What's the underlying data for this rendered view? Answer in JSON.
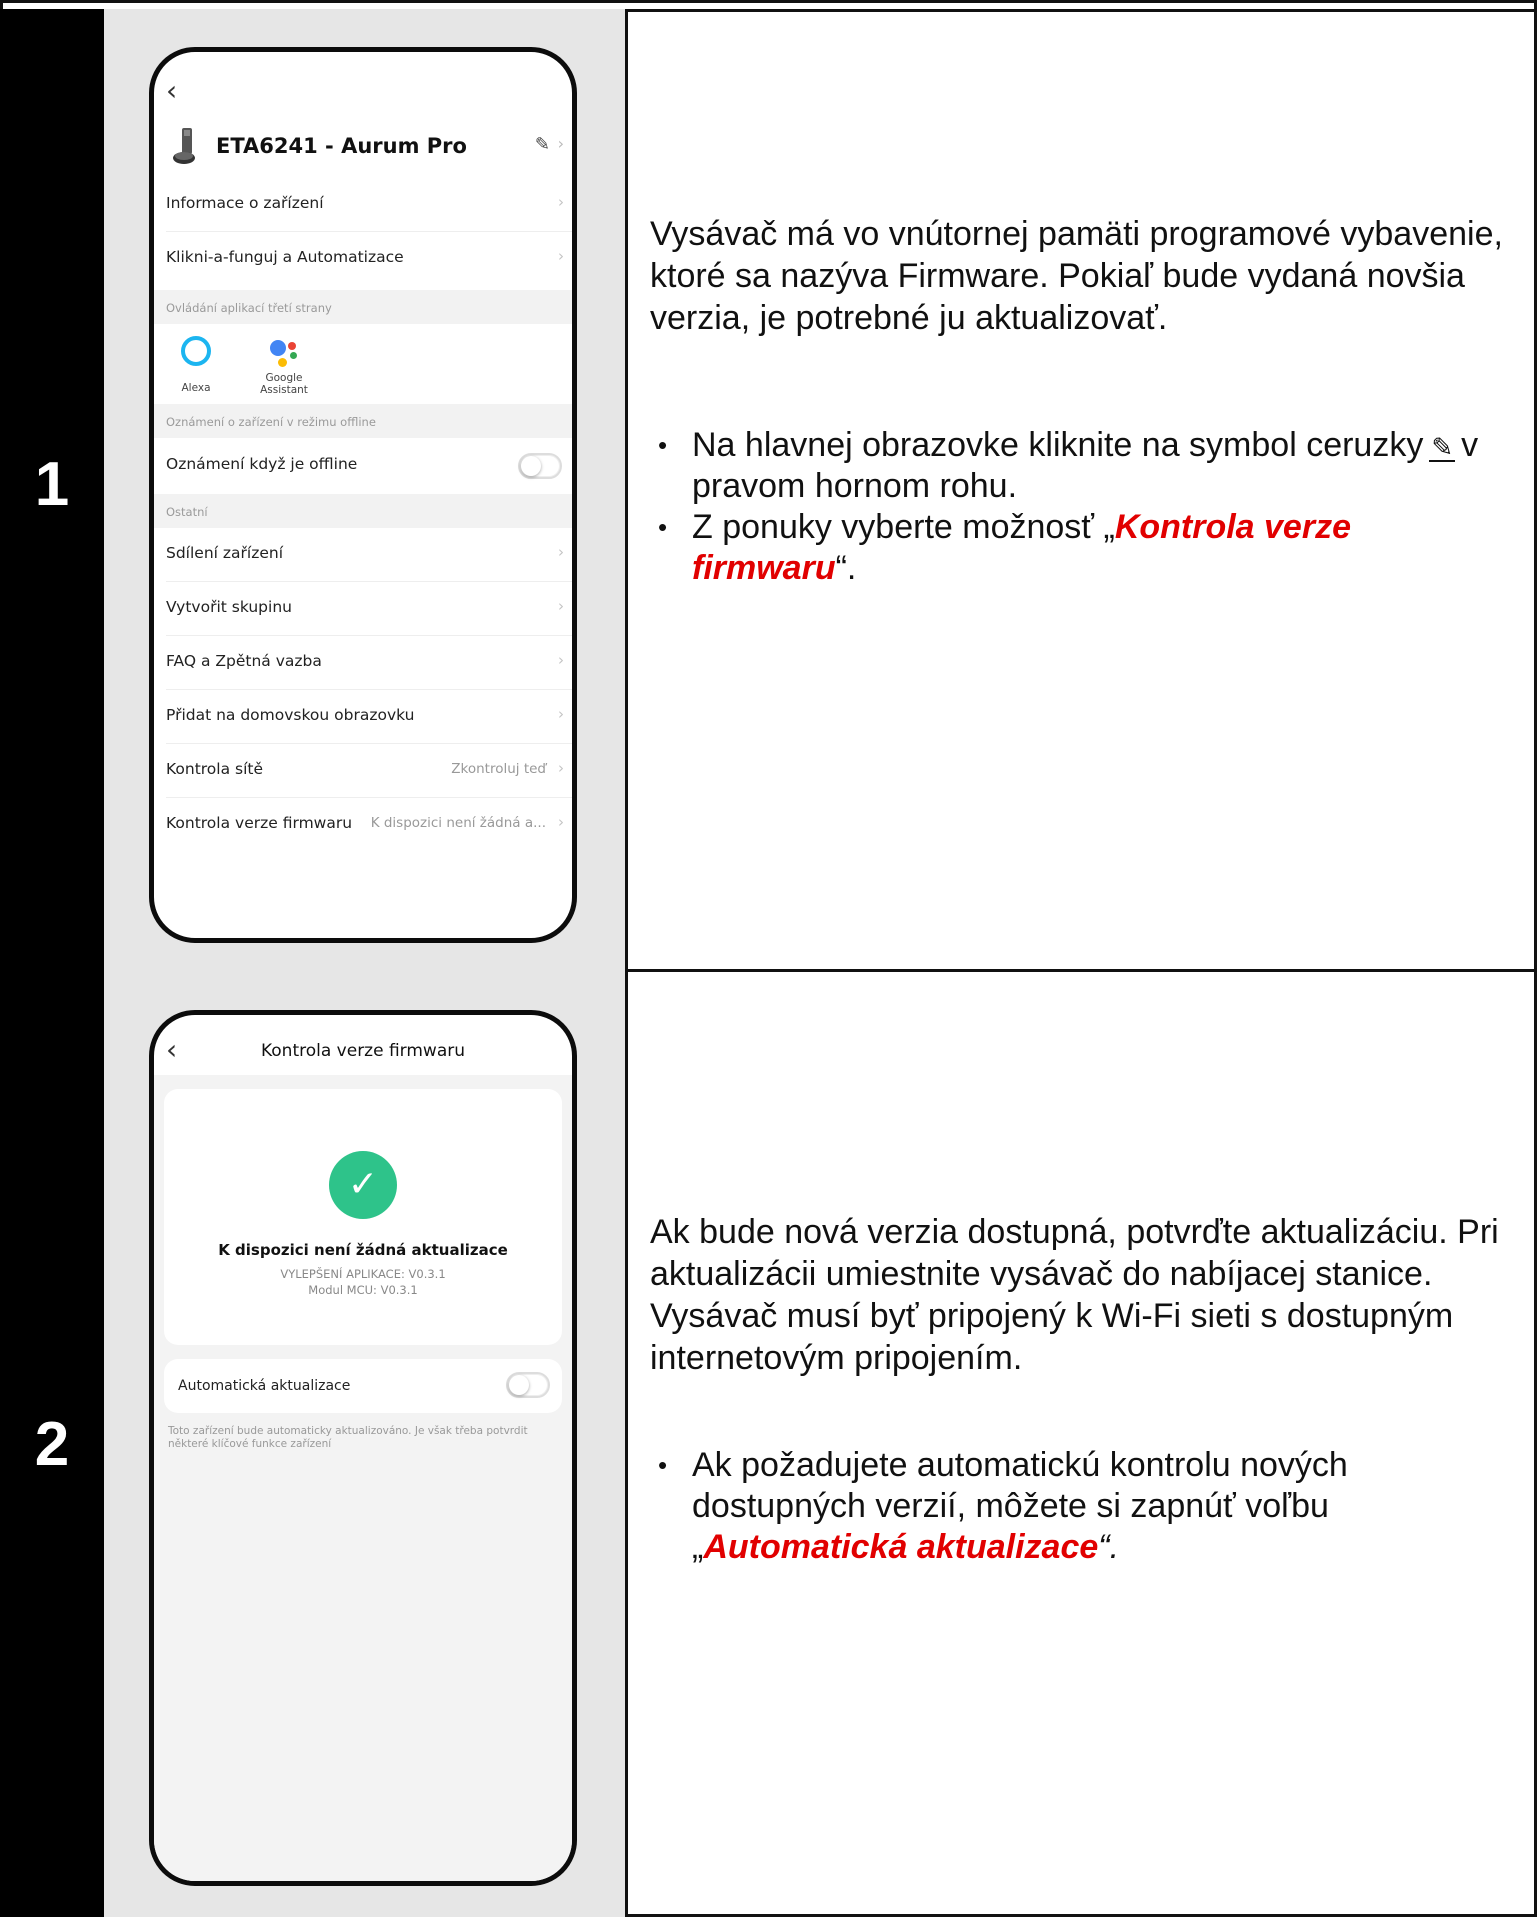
{
  "steps": [
    {
      "number": "1",
      "phone": {
        "back": "‹",
        "device_name": "ETA6241 - Aurum Pro",
        "menu_top": [
          {
            "label": "Informace o zařízení"
          },
          {
            "label": "Klikni-a-funguj a Automatizace"
          }
        ],
        "section_third_party": "Ovládání aplikací třetí strany",
        "third_party": [
          {
            "label": "Alexa"
          },
          {
            "label": "Google Assistant"
          }
        ],
        "section_offline": "Oznámení o zařízení v režimu offline",
        "offline_toggle_label": "Oznámení když je offline",
        "section_other": "Ostatní",
        "menu_other": [
          {
            "label": "Sdílení zařízení",
            "value": ""
          },
          {
            "label": "Vytvořit skupinu",
            "value": ""
          },
          {
            "label": "FAQ a Zpětná vazba",
            "value": ""
          },
          {
            "label": "Přidat na domovskou obrazovku",
            "value": ""
          },
          {
            "label": "Kontrola sítě",
            "value": "Zkontroluj teď"
          },
          {
            "label": "Kontrola verze firmwaru",
            "value": "K dispozici není žádná a..."
          }
        ]
      },
      "text": {
        "paragraph": "Vysávač má vo vnútornej pamäti programové vybavenie, ktoré sa nazýva Firmware. Pokiaľ bude vydaná novšia verzia, je potrebné ju aktualizovať.",
        "bullet1_before": "Na hlavnej obrazovke kliknite na symbol ceruzky",
        "bullet1_after": "v pravom hornom rohu.",
        "bullet2_before": "Z ponuky vyberte možnosť „",
        "bullet2_emph": "Kontrola verze firmwaru",
        "bullet2_after": "“."
      }
    },
    {
      "number": "2",
      "phone": {
        "back": "‹",
        "title": "Kontrola verze firmwaru",
        "status": "K dispozici není žádná aktualizace",
        "app_version": "VYLEPŠENÍ APLIKACE: V0.3.1",
        "mcu_version": "Modul MCU: V0.3.1",
        "auto_update_label": "Automatická aktualizace",
        "auto_update_note": "Toto zařízení bude automaticky aktualizováno. Je však třeba potvrdit některé klíčové funkce zařízení"
      },
      "text": {
        "paragraph": "Ak bude nová verzia dostupná, potvrďte aktualizáciu. Pri aktualizácii umiestnite vysávač do nabíjacej stanice. Vysávač musí byť pripojený k Wi-Fi sieti s dostupným internetovým pripojením.",
        "bullet1_before": "Ak požadujete automatickú kontrolu nových dostupných verzií, môžete si zapnúť voľbu „",
        "bullet1_emph": "Automatická aktualizace",
        "bullet1_after": "“."
      }
    }
  ],
  "colors": {
    "emphasis": "#e10000",
    "check": "#2ec38a",
    "alexa": "#1cb5f0"
  },
  "icons": [
    "chevron-left-icon",
    "robot-vacuum-icon",
    "pencil-icon",
    "chevron-right-icon",
    "alexa-icon",
    "google-assistant-icon",
    "toggle-switch",
    "checkmark-icon"
  ]
}
